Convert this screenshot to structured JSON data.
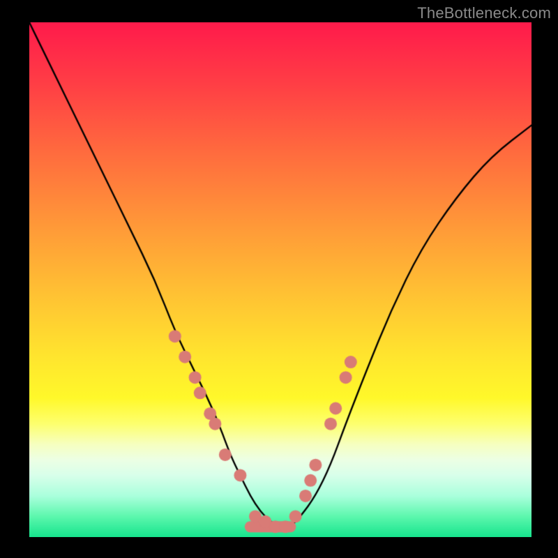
{
  "watermark": "TheBottleneck.com",
  "chart_data": {
    "type": "line",
    "title": "",
    "xlabel": "",
    "ylabel": "",
    "xlim": [
      0,
      100
    ],
    "ylim": [
      0,
      100
    ],
    "grid": false,
    "series": [
      {
        "name": "bottleneck-curve",
        "x": [
          0,
          5,
          10,
          15,
          20,
          25,
          29,
          33,
          37,
          40,
          42,
          44,
          46,
          48,
          50,
          52,
          54,
          57,
          60,
          63,
          67,
          72,
          78,
          85,
          92,
          100
        ],
        "values": [
          100,
          90,
          80,
          70,
          60,
          50,
          40,
          32,
          24,
          16,
          12,
          8,
          5,
          3,
          2,
          2,
          4,
          8,
          14,
          22,
          32,
          44,
          56,
          66,
          74,
          80
        ]
      }
    ],
    "markers": {
      "name": "highlight-points",
      "color": "#d97b76",
      "radius_px": 9,
      "x": [
        29,
        31,
        33,
        34,
        36,
        37,
        39,
        42,
        45,
        47,
        49,
        51,
        53,
        55,
        56,
        57,
        60,
        61,
        63,
        64
      ],
      "values": [
        39,
        35,
        31,
        28,
        24,
        22,
        16,
        12,
        4,
        3,
        2,
        2,
        4,
        8,
        11,
        14,
        22,
        25,
        31,
        34
      ]
    },
    "flat_markers": {
      "name": "bottom-run",
      "color": "#d97b76",
      "x": [
        44,
        46,
        48,
        50,
        52
      ],
      "values": [
        2,
        2,
        2,
        2,
        2
      ],
      "thickness_px": 16
    }
  }
}
